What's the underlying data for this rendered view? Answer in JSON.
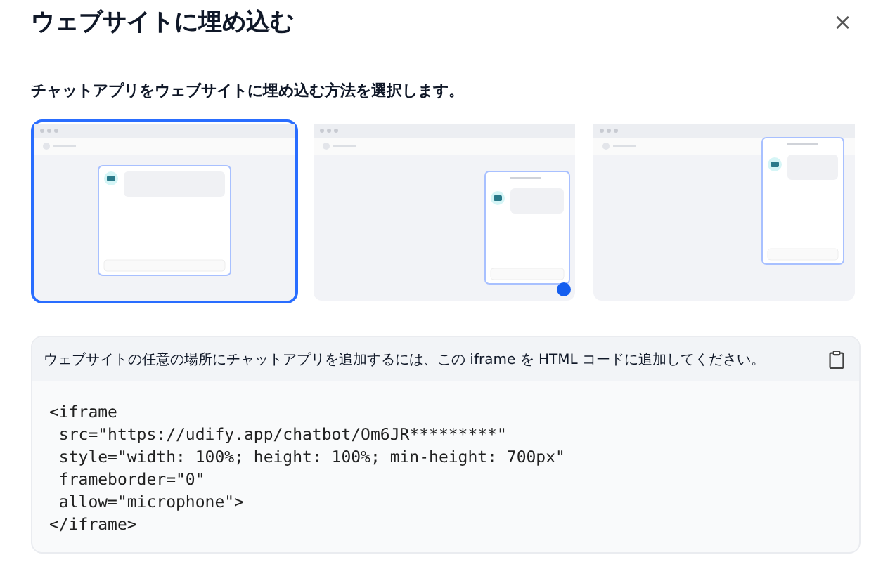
{
  "dialog": {
    "title": "ウェブサイトに埋め込む",
    "close": "×"
  },
  "subtitle": "チャットアプリをウェブサイトに埋め込む方法を選択します。",
  "options": [
    {
      "kind": "fullscreen",
      "selected": true
    },
    {
      "kind": "bubble",
      "selected": false
    },
    {
      "kind": "sidebar",
      "selected": false
    }
  ],
  "code_panel": {
    "instruction": "ウェブサイトの任意の場所にチャットアプリを追加するには、この iframe を HTML コードに追加してください。",
    "lines": [
      "<iframe",
      " src=\"https://udify.app/chatbot/Om6JR*********\"",
      " style=\"width: 100%; height: 100%; min-height: 700px\"",
      " frameborder=\"0\"",
      " allow=\"microphone\">",
      "</iframe>"
    ]
  }
}
